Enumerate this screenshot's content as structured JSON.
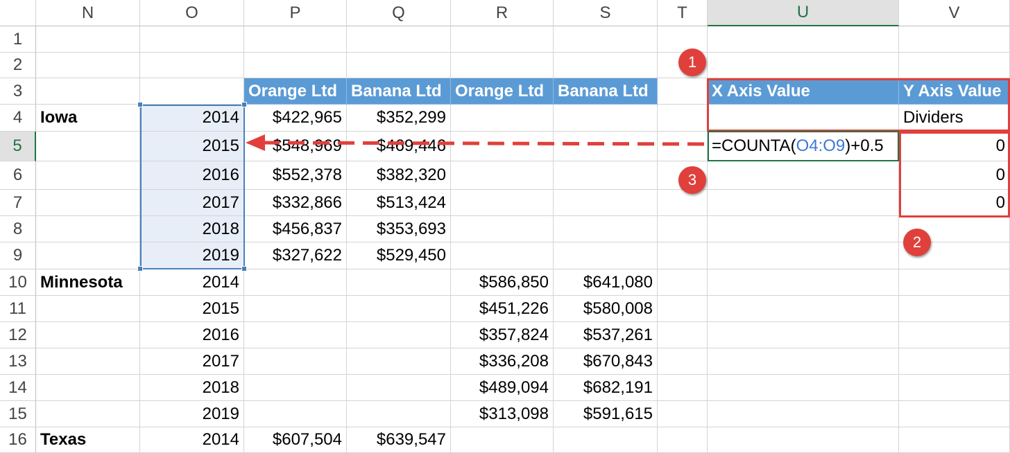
{
  "columns": [
    "N",
    "O",
    "P",
    "Q",
    "R",
    "S",
    "T",
    "U",
    "V"
  ],
  "rows": [
    "1",
    "2",
    "3",
    "4",
    "5",
    "6",
    "7",
    "8",
    "9",
    "10",
    "11",
    "12",
    "13",
    "14",
    "15",
    "16"
  ],
  "headers": {
    "P3": "Orange Ltd",
    "Q3": "Banana Ltd",
    "R3": "Orange Ltd",
    "S3": "Banana Ltd",
    "U3": "X Axis Value",
    "V3": "Y Axis Value"
  },
  "states": {
    "N4": "Iowa",
    "N10": "Minnesota",
    "N16": "Texas"
  },
  "years": {
    "O4": "2014",
    "O5": "2015",
    "O6": "2016",
    "O7": "2017",
    "O8": "2018",
    "O9": "2019",
    "O10": "2014",
    "O11": "2015",
    "O12": "2016",
    "O13": "2017",
    "O14": "2018",
    "O15": "2019",
    "O16": "2014"
  },
  "values": {
    "P4": "$422,965",
    "Q4": "$352,299",
    "P5": "$548,969",
    "Q5": "$469,446",
    "P6": "$552,378",
    "Q6": "$382,320",
    "P7": "$332,866",
    "Q7": "$513,424",
    "P8": "$456,837",
    "Q8": "$353,693",
    "P9": "$327,622",
    "Q9": "$529,450",
    "R10": "$586,850",
    "S10": "$641,080",
    "R11": "$451,226",
    "S11": "$580,008",
    "R12": "$357,824",
    "S12": "$537,261",
    "R13": "$336,208",
    "S13": "$670,843",
    "R14": "$489,094",
    "S14": "$682,191",
    "R15": "$313,098",
    "S15": "$591,615",
    "P16": "$607,504",
    "Q16": "$639,547"
  },
  "labels": {
    "V4": "Dividers"
  },
  "zeros": {
    "V5": "0",
    "V6": "0",
    "V7": "0"
  },
  "formula": {
    "prefix": "=COUNTA(",
    "ref": "O4:O9",
    "suffix": ")+0.5"
  },
  "callouts": [
    "1",
    "2",
    "3"
  ],
  "colors": {
    "header_blue": "#5b9bd5",
    "callout_red": "#e0403c",
    "selection_blue": "#4a7ebb",
    "active_green": "#217346"
  }
}
